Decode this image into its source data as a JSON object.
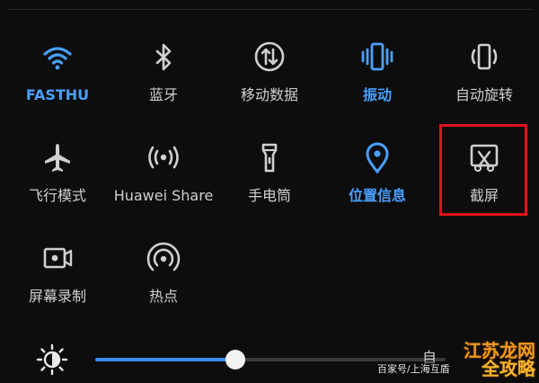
{
  "colors": {
    "accent": "#4aa0ff",
    "inactive": "#cfcfcf",
    "highlight_border": "#e0121b",
    "background": "#0d0d0d"
  },
  "quick_settings": {
    "tiles": [
      {
        "label": "FASTHU",
        "icon": "wifi-icon",
        "active": true
      },
      {
        "label": "蓝牙",
        "icon": "bluetooth-icon",
        "active": false
      },
      {
        "label": "移动数据",
        "icon": "mobile-data-icon",
        "active": false
      },
      {
        "label": "振动",
        "icon": "vibrate-icon",
        "active": true
      },
      {
        "label": "自动旋转",
        "icon": "auto-rotate-icon",
        "active": false
      },
      {
        "label": "飞行模式",
        "icon": "airplane-icon",
        "active": false
      },
      {
        "label": "Huawei Share",
        "icon": "huawei-share-icon",
        "active": false
      },
      {
        "label": "手电筒",
        "icon": "flashlight-icon",
        "active": false
      },
      {
        "label": "位置信息",
        "icon": "location-icon",
        "active": true
      },
      {
        "label": "截屏",
        "icon": "screenshot-icon",
        "active": false
      },
      {
        "label": "屏幕录制",
        "icon": "screen-record-icon",
        "active": false
      },
      {
        "label": "热点",
        "icon": "hotspot-icon",
        "active": false
      }
    ]
  },
  "brightness": {
    "icon": "brightness-icon",
    "level": 0.4,
    "auto_label": "自"
  },
  "watermark": {
    "text": "百家号/上海互盾"
  },
  "logo": {
    "line1": "江苏龙网",
    "line2": "全攻略"
  }
}
